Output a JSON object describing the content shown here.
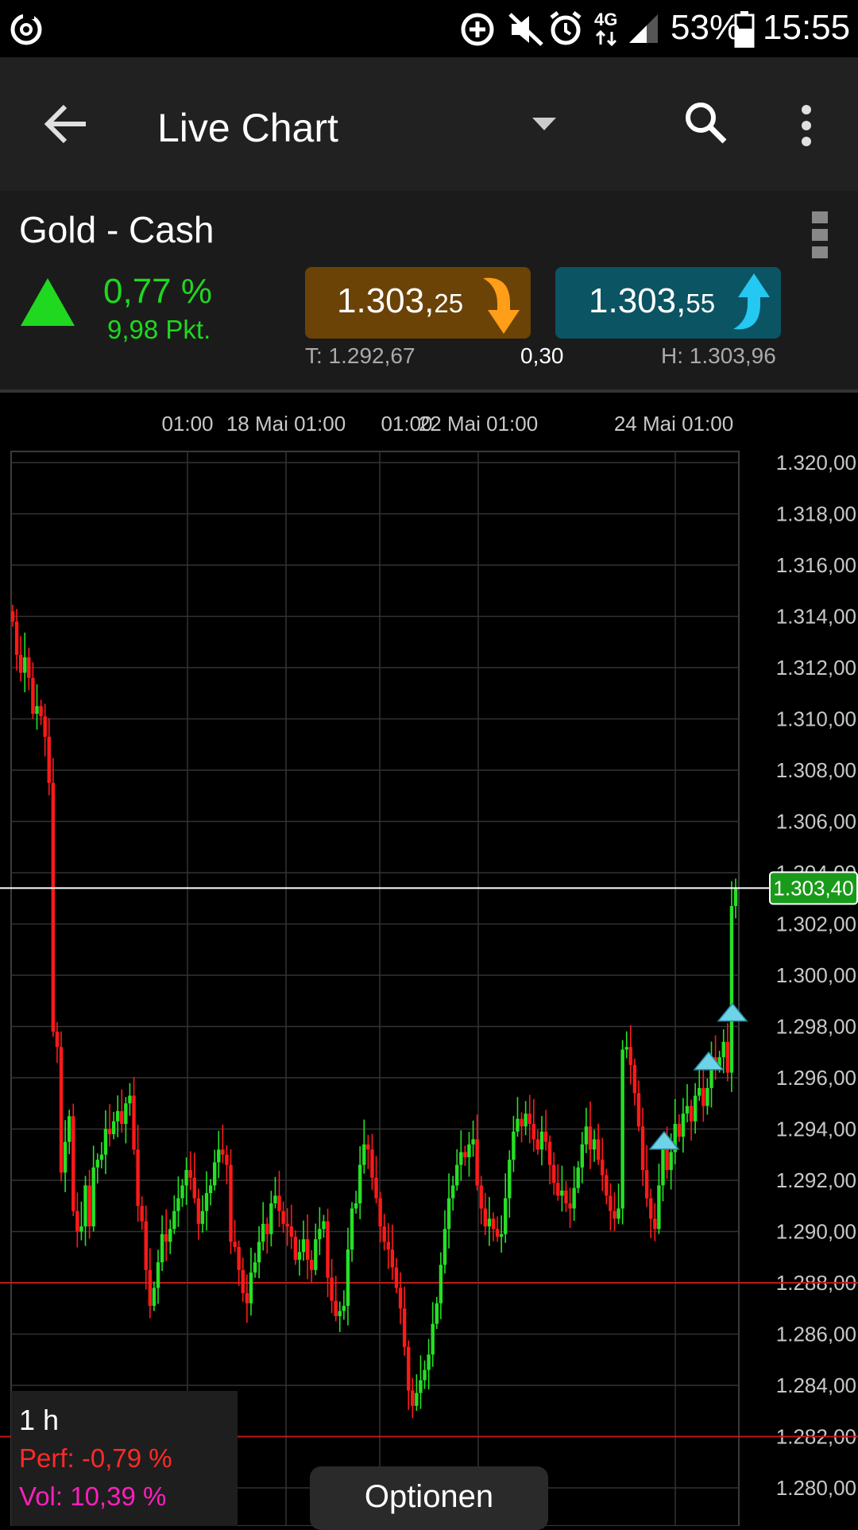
{
  "status_bar": {
    "battery": "53%",
    "time": "15:55",
    "network": "4G"
  },
  "app_bar": {
    "title": "Live Chart",
    "icons": [
      "back-arrow-icon",
      "dropdown-caret-icon",
      "search-icon",
      "overflow-menu-icon"
    ]
  },
  "instrument": {
    "name": "Gold - Cash",
    "change_pct": "0,77 %",
    "change_pts": "9,98 Pkt.",
    "bid_main": "1.303,",
    "bid_small": "25",
    "ask_main": "1.303,",
    "ask_small": "55",
    "low": "T: 1.292,67",
    "spread": "0,30",
    "high": "H: 1.303,96",
    "colors": {
      "up": "#1fd81f",
      "bid_bg": "#6b4306",
      "ask_bg": "#0b5463"
    }
  },
  "chart_data": {
    "type": "candlestick",
    "x_tick_labels": [
      "01:00",
      "18 Mai 01:00",
      "01:00",
      "22 Mai 01:00",
      "24 Mai 01:00"
    ],
    "y_tick_labels": [
      "1.320,00",
      "1.318,00",
      "1.316,00",
      "1.314,00",
      "1.312,00",
      "1.310,00",
      "1.308,00",
      "1.306,00",
      "1.304,00",
      "1.302,00",
      "1.300,00",
      "1.298,00",
      "1.296,00",
      "1.294,00",
      "1.292,00",
      "1.290,00",
      "1.288,00",
      "1.286,00",
      "1.284,00",
      "1.282,00",
      "1.280,00"
    ],
    "ylim": [
      1279.0,
      1321.0
    ],
    "current_price_label": "1.303,40",
    "current_price": 1303.4,
    "h_lines": [
      1288.0,
      1282.0
    ],
    "markers": [
      1293.4,
      1296.5,
      1298.4
    ],
    "closes": [
      1313.8,
      1312.5,
      1311.8,
      1312.4,
      1311.6,
      1310.2,
      1310.5,
      1310.1,
      1309.3,
      1307.5,
      1297.8,
      1297.2,
      1292.3,
      1293.5,
      1294.5,
      1290.8,
      1290.0,
      1290.2,
      1291.8,
      1290.2,
      1292.5,
      1292.8,
      1293.0,
      1294.0,
      1293.8,
      1294.3,
      1294.7,
      1294.2,
      1295.0,
      1295.3,
      1293.2,
      1291.0,
      1290.4,
      1288.5,
      1287.1,
      1287.8,
      1288.8,
      1289.9,
      1289.6,
      1290.1,
      1290.8,
      1291.3,
      1291.8,
      1292.4,
      1292.1,
      1291.3,
      1290.3,
      1290.8,
      1291.5,
      1291.8,
      1292.7,
      1293.2,
      1293.0,
      1292.6,
      1289.6,
      1289.4,
      1288.5,
      1287.6,
      1287.2,
      1288.4,
      1288.8,
      1289.6,
      1290.3,
      1289.9,
      1291.1,
      1291.4,
      1290.8,
      1290.3,
      1290.2,
      1289.8,
      1288.9,
      1289.2,
      1289.7,
      1288.9,
      1288.5,
      1289.7,
      1290.1,
      1290.4,
      1288.2,
      1287.3,
      1286.7,
      1286.9,
      1287.1,
      1289.3,
      1290.9,
      1291.1,
      1292.6,
      1293.4,
      1293.2,
      1292.1,
      1291.3,
      1290.2,
      1289.6,
      1289.3,
      1288.6,
      1287.8,
      1287.0,
      1285.5,
      1283.8,
      1283.2,
      1283.7,
      1284.2,
      1284.6,
      1285.2,
      1286.4,
      1287.2,
      1288.7,
      1290.1,
      1291.3,
      1291.8,
      1292.6,
      1293.1,
      1292.9,
      1293.4,
      1293.6,
      1291.8,
      1290.9,
      1290.2,
      1290.5,
      1290.1,
      1289.8,
      1289.9,
      1291.3,
      1292.8,
      1293.9,
      1294.4,
      1294.1,
      1294.6,
      1294.2,
      1293.6,
      1293.2,
      1293.9,
      1293.5,
      1292.6,
      1291.9,
      1291.4,
      1291.6,
      1291.1,
      1290.9,
      1291.7,
      1292.5,
      1293.4,
      1294.1,
      1293.2,
      1293.6,
      1292.8,
      1292.2,
      1291.4,
      1290.8,
      1290.5,
      1290.9,
      1297.1,
      1297.2,
      1296.5,
      1295.4,
      1294.1,
      1292.4,
      1291.3,
      1290.5,
      1290.1,
      1291.8,
      1293.6,
      1292.4,
      1293.1,
      1294.2,
      1293.7,
      1294.6,
      1294.9,
      1294.3,
      1295.3,
      1295.6,
      1294.9,
      1295.6,
      1296.8,
      1296.4,
      1296.8,
      1297.4,
      1296.2,
      1302.7,
      1303.4
    ]
  },
  "info": {
    "interval": "1 h",
    "perf": "Perf: -0,79 %",
    "vol": "Vol: 10,39 %"
  },
  "options_label": "Optionen"
}
